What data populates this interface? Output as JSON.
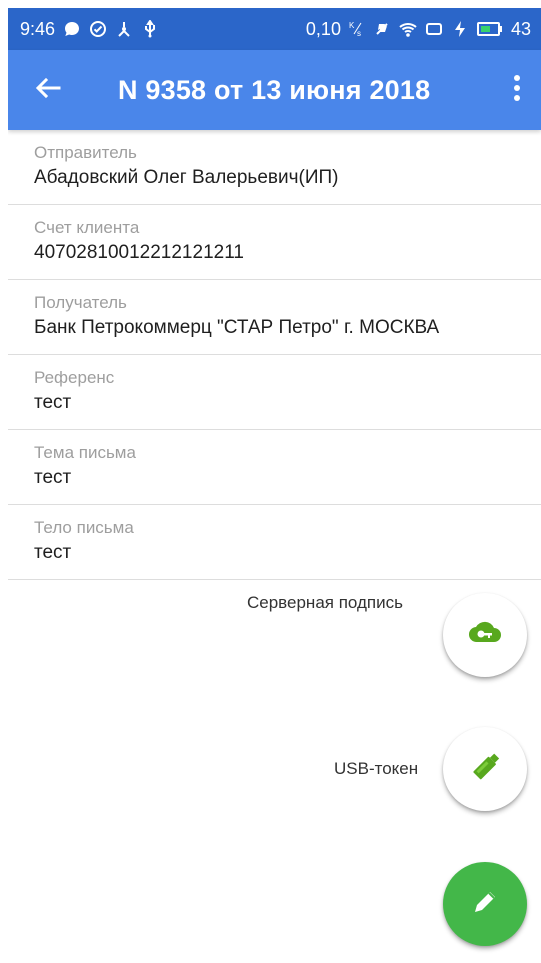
{
  "status_bar": {
    "time": "9:46",
    "network_speed": "0,10",
    "battery": "43",
    "speed_unit_icon": "kbps-icon",
    "icons": [
      "chat-bubble-icon",
      "check-circle-icon",
      "usb-connect-icon",
      "usb-icon",
      "no-sound-icon",
      "wifi-icon",
      "screen-icon",
      "charging-icon",
      "battery-icon"
    ]
  },
  "app_bar": {
    "title": "N 9358 от 13 июня 2018",
    "back_icon": "arrow-left-icon",
    "menu_icon": "more-vertical-icon",
    "color": "#4a86ea",
    "status_bar_color": "#2b66c9"
  },
  "fields": [
    {
      "label": "Отправитель",
      "value": "Абадовский Олег Валерьевич(ИП)"
    },
    {
      "label": "Счет клиента",
      "value": "40702810012212121211"
    },
    {
      "label": "Получатель",
      "value": "Банк Петрокоммерц  \"СТАР Петро\" г. МОСКВА"
    },
    {
      "label": "Референс",
      "value": "тест"
    },
    {
      "label": "Тема письма",
      "value": "тест"
    },
    {
      "label": "Тело письма",
      "value": "тест"
    }
  ],
  "actions": {
    "server_signature": {
      "label": "Серверная подпись",
      "icon": "cloud-key-icon"
    },
    "usb_token": {
      "label": "USB-токен",
      "icon": "usb-stick-icon"
    },
    "edit": {
      "icon": "pencil-icon"
    }
  },
  "colors": {
    "accent_green": "#43b749",
    "icon_green": "#58a81e",
    "field_label": "#9e9e9e",
    "field_value": "#1f1f1f"
  }
}
